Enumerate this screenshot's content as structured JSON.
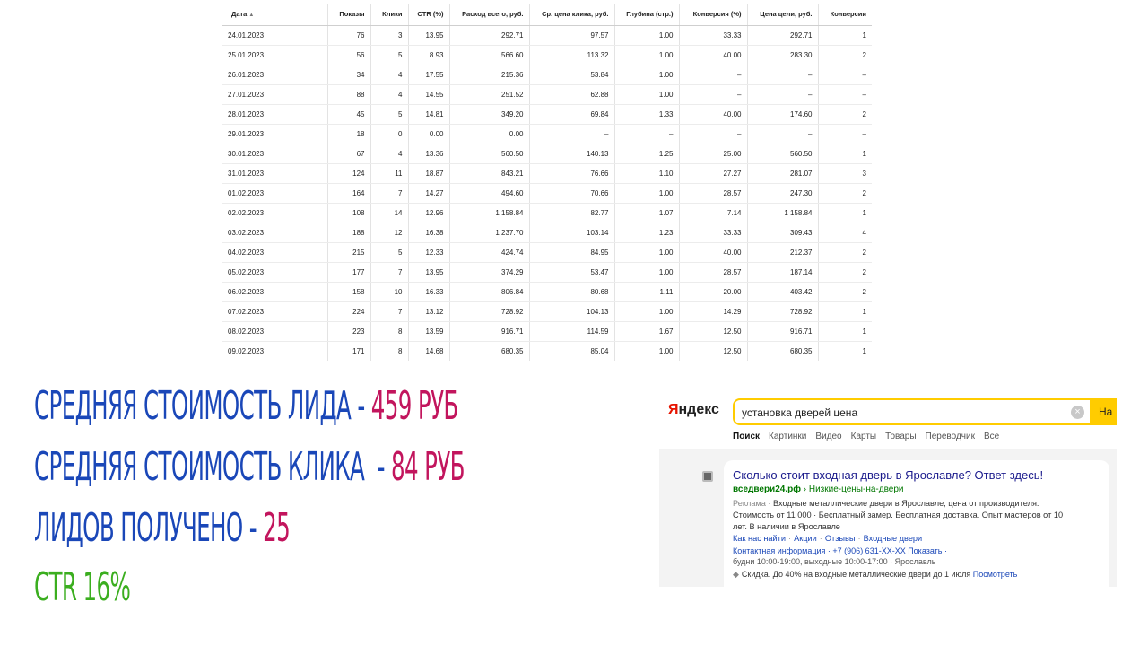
{
  "table": {
    "sort_arrow": "▲",
    "columns": [
      "Дата",
      "Показы",
      "Клики",
      "CTR (%)",
      "Расход всего, руб.",
      "Ср. цена клика, руб.",
      "Глубина (стр.)",
      "Конверсия (%)",
      "Цена цели, руб.",
      "Конверсии"
    ],
    "rows": [
      [
        "24.01.2023",
        "76",
        "3",
        "13.95",
        "292.71",
        "97.57",
        "1.00",
        "33.33",
        "292.71",
        "1"
      ],
      [
        "25.01.2023",
        "56",
        "5",
        "8.93",
        "566.60",
        "113.32",
        "1.00",
        "40.00",
        "283.30",
        "2"
      ],
      [
        "26.01.2023",
        "34",
        "4",
        "17.55",
        "215.36",
        "53.84",
        "1.00",
        "–",
        "–",
        "–"
      ],
      [
        "27.01.2023",
        "88",
        "4",
        "14.55",
        "251.52",
        "62.88",
        "1.00",
        "–",
        "–",
        "–"
      ],
      [
        "28.01.2023",
        "45",
        "5",
        "14.81",
        "349.20",
        "69.84",
        "1.33",
        "40.00",
        "174.60",
        "2"
      ],
      [
        "29.01.2023",
        "18",
        "0",
        "0.00",
        "0.00",
        "–",
        "–",
        "–",
        "–",
        "–"
      ],
      [
        "30.01.2023",
        "67",
        "4",
        "13.36",
        "560.50",
        "140.13",
        "1.25",
        "25.00",
        "560.50",
        "1"
      ],
      [
        "31.01.2023",
        "124",
        "11",
        "18.87",
        "843.21",
        "76.66",
        "1.10",
        "27.27",
        "281.07",
        "3"
      ],
      [
        "01.02.2023",
        "164",
        "7",
        "14.27",
        "494.60",
        "70.66",
        "1.00",
        "28.57",
        "247.30",
        "2"
      ],
      [
        "02.02.2023",
        "108",
        "14",
        "12.96",
        "1 158.84",
        "82.77",
        "1.07",
        "7.14",
        "1 158.84",
        "1"
      ],
      [
        "03.02.2023",
        "188",
        "12",
        "16.38",
        "1 237.70",
        "103.14",
        "1.23",
        "33.33",
        "309.43",
        "4"
      ],
      [
        "04.02.2023",
        "215",
        "5",
        "12.33",
        "424.74",
        "84.95",
        "1.00",
        "40.00",
        "212.37",
        "2"
      ],
      [
        "05.02.2023",
        "177",
        "7",
        "13.95",
        "374.29",
        "53.47",
        "1.00",
        "28.57",
        "187.14",
        "2"
      ],
      [
        "06.02.2023",
        "158",
        "10",
        "16.33",
        "806.84",
        "80.68",
        "1.11",
        "20.00",
        "403.42",
        "2"
      ],
      [
        "07.02.2023",
        "224",
        "7",
        "13.12",
        "728.92",
        "104.13",
        "1.00",
        "14.29",
        "728.92",
        "1"
      ],
      [
        "08.02.2023",
        "223",
        "8",
        "13.59",
        "916.71",
        "114.59",
        "1.67",
        "12.50",
        "916.71",
        "1"
      ],
      [
        "09.02.2023",
        "171",
        "8",
        "14.68",
        "680.35",
        "85.04",
        "1.00",
        "12.50",
        "680.35",
        "1"
      ]
    ]
  },
  "stats": {
    "lead_cost": {
      "label": "Средняя стоимость лида - ",
      "value": "459 руб"
    },
    "click_cost": {
      "label": "Средняя стоимость клика  - ",
      "value": "84 руб"
    },
    "leads": {
      "label": "Лидов получено - ",
      "value": "25"
    },
    "ctr": {
      "label": "CTR ",
      "value": "16%"
    }
  },
  "colors": {
    "label_blue": "#1a47b8",
    "value_magenta": "#c2155d",
    "ctr_green": "#3bae1f",
    "yandex_yellow": "#ffcc00"
  },
  "yandex": {
    "logo_first": "Я",
    "logo_rest": "ндекс",
    "search_value": "установка дверей цена",
    "clear_icon": "×",
    "search_button": "На",
    "tabs": [
      "Поиск",
      "Картинки",
      "Видео",
      "Карты",
      "Товары",
      "Переводчик",
      "Все"
    ],
    "ad": {
      "title": "Сколько стоит входная дверь в Ярославле? Ответ здесь!",
      "domain": "вседвери24.рф",
      "path": " › Низкие-цены-на-двери",
      "line1_muted": "Реклама · ",
      "line1": "Входные металлические двери в Ярославле, цена от производителя.",
      "line2": "Стоимость от 11 000 · Бесплатный замер. Бесплатная доставка. Опыт мастеров от 10",
      "line3": "лет. В наличии в Ярославле",
      "sitelinks": [
        "Как нас найти",
        "Акции",
        "Отзывы",
        "Входные двери"
      ],
      "sitelink_sep": "·",
      "contact": "Контактная информация · +7 (906) 631-XX-XX Показать ·",
      "hours": "будни 10:00-19:00, выходные 10:00-17:00 · Ярославль",
      "promo_text": "Скидка. До 40% на входные металлические двери до 1 июля ",
      "promo_link": "Посмотреть"
    }
  }
}
